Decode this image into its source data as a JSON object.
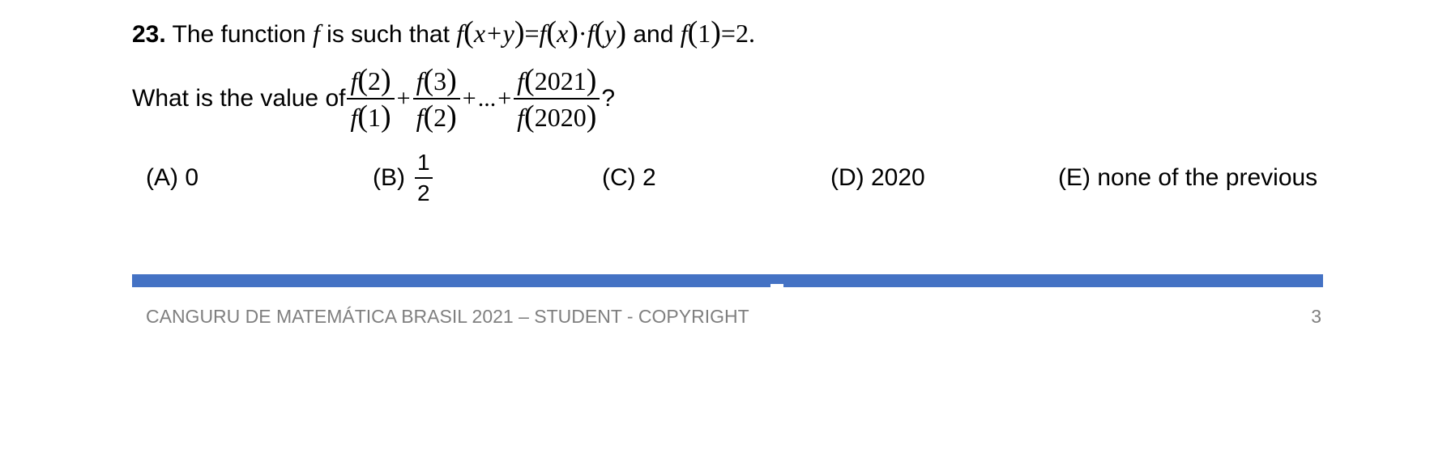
{
  "question": {
    "number": "23.",
    "intro": " The function ",
    "f_symbol": "f",
    "middle": " is such that ",
    "func_eq": {
      "lhs_f": "f",
      "lhs_arg": "x+y",
      "eq": "=",
      "rhs1_f": "f",
      "rhs1_arg": "x",
      "dot": "·",
      "rhs2_f": "f",
      "rhs2_arg": "y"
    },
    "and_text": " and ",
    "init_cond": {
      "f": "f",
      "arg": "1",
      "eq": "=",
      "value": "2",
      "period": "."
    },
    "prompt": "What is the value of ",
    "sum_terms": {
      "t1_num_f": "f",
      "t1_num_arg": "2",
      "t1_den_f": "f",
      "t1_den_arg": "1",
      "plus1": "+",
      "t2_num_f": "f",
      "t2_num_arg": "3",
      "t2_den_f": "f",
      "t2_den_arg": "2",
      "plus2": "+",
      "ellipsis": "...",
      "plus3": "+",
      "t3_num_f": "f",
      "t3_num_arg": "2021",
      "t3_den_f": "f",
      "t3_den_arg": "2020"
    },
    "question_mark": " ?"
  },
  "options": {
    "a": "(A) 0",
    "b_label": "(B)",
    "b_num": "1",
    "b_den": "2",
    "c": "(C) 2",
    "d": "(D) 2020",
    "e": "(E) none of the previous"
  },
  "footer": {
    "text": "CANGURU DE MATEMÁTICA BRASIL 2021 – STUDENT - COPYRIGHT",
    "page_number": "3",
    "bar_color": "#4472c4"
  }
}
